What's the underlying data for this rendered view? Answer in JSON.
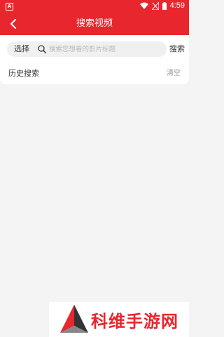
{
  "status_bar": {
    "sim_label": "A",
    "time": "4:59"
  },
  "header": {
    "title": "搜索视频",
    "accent": "#e8262d"
  },
  "search": {
    "type_selector": "选择",
    "placeholder": "搜索您想看的影片标题",
    "value": "",
    "submit_label": "搜索"
  },
  "history": {
    "label": "历史搜索",
    "clear_label": "清空"
  },
  "watermark": {
    "text": "科维手游网"
  }
}
